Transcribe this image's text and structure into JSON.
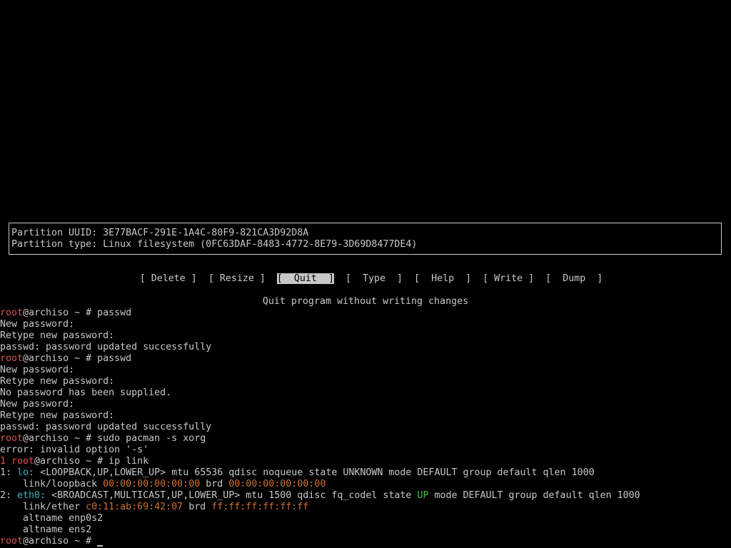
{
  "partition_info": {
    "uuid_line": "Partition UUID: 3E77BACF-291E-1A4C-80F9-821CA3D92D8A",
    "type_line": "Partition type: Linux filesystem (0FC63DAF-8483-4772-8E79-3D69D8477DE4)"
  },
  "menu": {
    "delete": "[ Delete ]",
    "resize": "[ Resize ]",
    "quit": "[  Quit  ]",
    "type": "[  Type  ]",
    "help": "[  Help  ]",
    "write": "[ Write ]",
    "dump": "[  Dump  ]"
  },
  "hint": "Quit program without writing changes",
  "prompt": {
    "user": "root",
    "host": "@archiso ~ # "
  },
  "terminal": {
    "l1_cmd": "passwd",
    "l2": "New password:",
    "l3": "Retype new password:",
    "l4": "passwd: password updated successfully",
    "l5_cmd": "passwd",
    "l6": "New password:",
    "l7": "Retype new password:",
    "l8": "No password has been supplied.",
    "l9": "New password:",
    "l10": "Retype new password:",
    "l11": "passwd: password updated successfully",
    "l12_cmd": "sudo pacman -s xorg",
    "l13": "error: invalid option '-s'",
    "l14_status": "1 ",
    "l14_cmd": "ip link",
    "l15_num": "1: ",
    "l15_iface": "lo:",
    "l15_rest": " <LOOPBACK,UP,LOWER_UP> mtu 65536 qdisc noqueue state UNKNOWN mode DEFAULT group default qlen 1000",
    "l16_label": "    link/loopback ",
    "l16_mac": "00:00:00:00:00:00",
    "l16_brd": " brd ",
    "l16_brdmac": "00:00:00:00:00:00",
    "l17_num": "2: ",
    "l17_iface": "eth0:",
    "l17_rest1": " <BROADCAST,MULTICAST,UP,LOWER_UP> mtu 1500 qdisc fq_codel state ",
    "l17_state": "UP",
    "l17_rest2": " mode DEFAULT group default qlen 1000",
    "l18_label": "    link/ether ",
    "l18_mac": "c0:11:ab:69:42:07",
    "l18_brd": " brd ",
    "l18_brdmac": "ff:ff:ff:ff:ff:ff",
    "l19": "    altname enp0s2",
    "l20": "    altname ens2"
  },
  "colors": {
    "background": "#000000",
    "text": "#c8c8c8",
    "prompt_user": "#e05050",
    "interface": "#40b0c0",
    "state_up": "#40c040",
    "mac": "#d07030"
  }
}
